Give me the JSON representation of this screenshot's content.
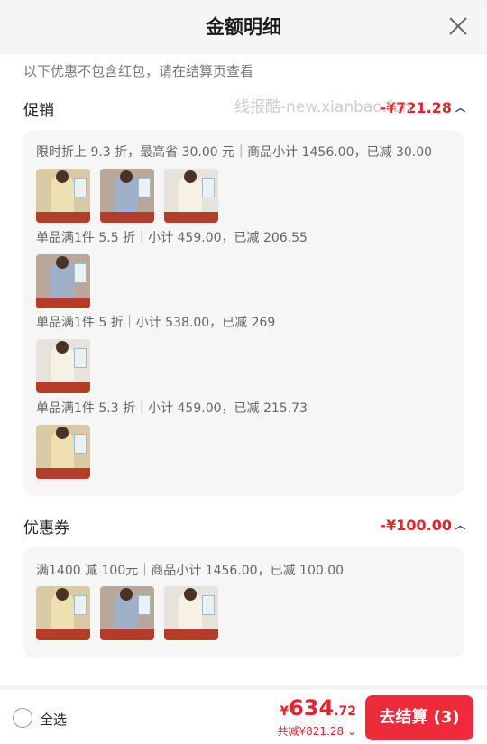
{
  "header": {
    "title": "金额明细"
  },
  "note": "以下优惠不包含红包，请在结算页查看",
  "watermark": "线报酷-new.xianbao.fun",
  "promo": {
    "title": "促销",
    "amount": "-¥721.28",
    "lines": [
      "限时折上 9.3 折，最高省 30.00 元｜商品小计 1456.00，已减 30.00",
      "单品满1件 5.5 折｜小计 459.00，已减 206.55",
      "单品满1件 5 折｜小计 538.00，已减 269",
      "单品满1件 5.3 折｜小计 459.00，已减 215.73"
    ]
  },
  "coupon": {
    "title": "优惠券",
    "amount": "-¥100.00",
    "line": "满1400 减 100元｜商品小计 1456.00，已减 100.00"
  },
  "footer": {
    "select_all": "全选",
    "price_symbol": "¥",
    "price_int": "634",
    "price_dec": ".72",
    "saved": "共减¥821.28",
    "checkout": "去结算 (3)"
  },
  "colors": {
    "accent": "#e3242b",
    "button": "#ef2a3a"
  },
  "icons": {
    "close": "close-icon",
    "caret": "chevron-up-icon",
    "radio": "radio-unchecked-icon"
  }
}
